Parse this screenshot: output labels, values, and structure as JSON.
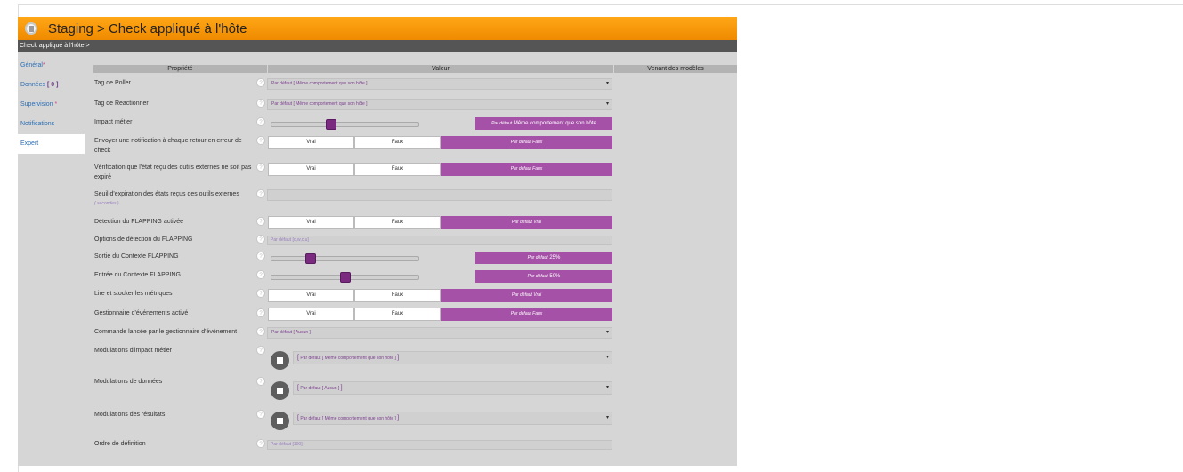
{
  "window": {
    "title": "Staging > Check appliqué à l'hôte",
    "breadcrumb": "Check appliqué à l'hôte >"
  },
  "sidebar": {
    "items": [
      {
        "label": "Général",
        "suffix": "*"
      },
      {
        "label": "Données",
        "suffix": "[ 0 ]"
      },
      {
        "label": "Supervision",
        "suffix": "*"
      },
      {
        "label": "Notifications",
        "suffix": ""
      },
      {
        "label": "Expert",
        "suffix": ""
      }
    ]
  },
  "table": {
    "col_property": "Propriété",
    "col_value": "Valeur",
    "col_models": "Venant des modèles"
  },
  "help_glyph": "?",
  "toggle": {
    "true_label": "Vrai",
    "false_label": "Faux",
    "default_prefix": "Par défaut"
  },
  "rows": {
    "poller": {
      "label": "Tag de Poller",
      "value": "Par défaut [ Même comportement que son hôte ]"
    },
    "reactionner": {
      "label": "Tag de Reactionner",
      "value": "Par défaut [ Même comportement que son hôte ]"
    },
    "impact": {
      "label": "Impact métier",
      "default_prefix": "Par défaut",
      "default_value": "Même comportement que son hôte",
      "level": 0.4
    },
    "notif_retry": {
      "label": "Envoyer une notification à chaque retour en erreur de check",
      "default_value": "Faux"
    },
    "freshness": {
      "label": "Vérification que l'état reçu des outils externes ne soit pas expiré",
      "default_value": "Faux"
    },
    "expiration": {
      "label": "Seuil d'expiration des états reçus des outils externes",
      "unit": "( secondes )"
    },
    "flapping": {
      "label": "Détection du FLAPPING activée",
      "default_value": "Vrai"
    },
    "flap_options": {
      "label": "Options de détection du FLAPPING",
      "value": "Par défaut [o,w,c,u]"
    },
    "flap_low": {
      "label": "Sortie du Contexte FLAPPING",
      "default_prefix": "Par défaut",
      "default_value": "25%",
      "level": 0.25
    },
    "flap_high": {
      "label": "Entrée du Contexte FLAPPING",
      "default_prefix": "Par défaut",
      "default_value": "50%",
      "level": 0.5
    },
    "perfdata": {
      "label": "Lire et stocker les métriques",
      "default_value": "Vrai"
    },
    "event_enabled": {
      "label": "Gestionnaire d'événements activé",
      "default_value": "Faux"
    },
    "event_cmd": {
      "label": "Commande lancée par le gestionnaire d'événement",
      "value": "Par défaut [ Aucun ]"
    },
    "mod_impact": {
      "label": "Modulations d'impact métier",
      "value": "Par défaut [ Même comportement que son hôte ]"
    },
    "mod_data": {
      "label": "Modulations de données",
      "value": "Par défaut [ Aucun ]"
    },
    "mod_results": {
      "label": "Modulations des résultats",
      "value": "Par défaut [ Même comportement que son hôte ]"
    },
    "order": {
      "label": "Ordre de définition",
      "value": "Par défaut [100]"
    }
  },
  "brackets": {
    "open": "[",
    "close": "]"
  },
  "colors": {
    "accent": "#a651a8",
    "title_bar": "#f59a0c",
    "breadcrumb_bar": "#555555",
    "link": "#2c6fb5"
  },
  "icons": {
    "title": "database-icon",
    "dropdown": "caret-down-icon",
    "modulation": "stop-icon",
    "help": "help-circle-icon"
  }
}
